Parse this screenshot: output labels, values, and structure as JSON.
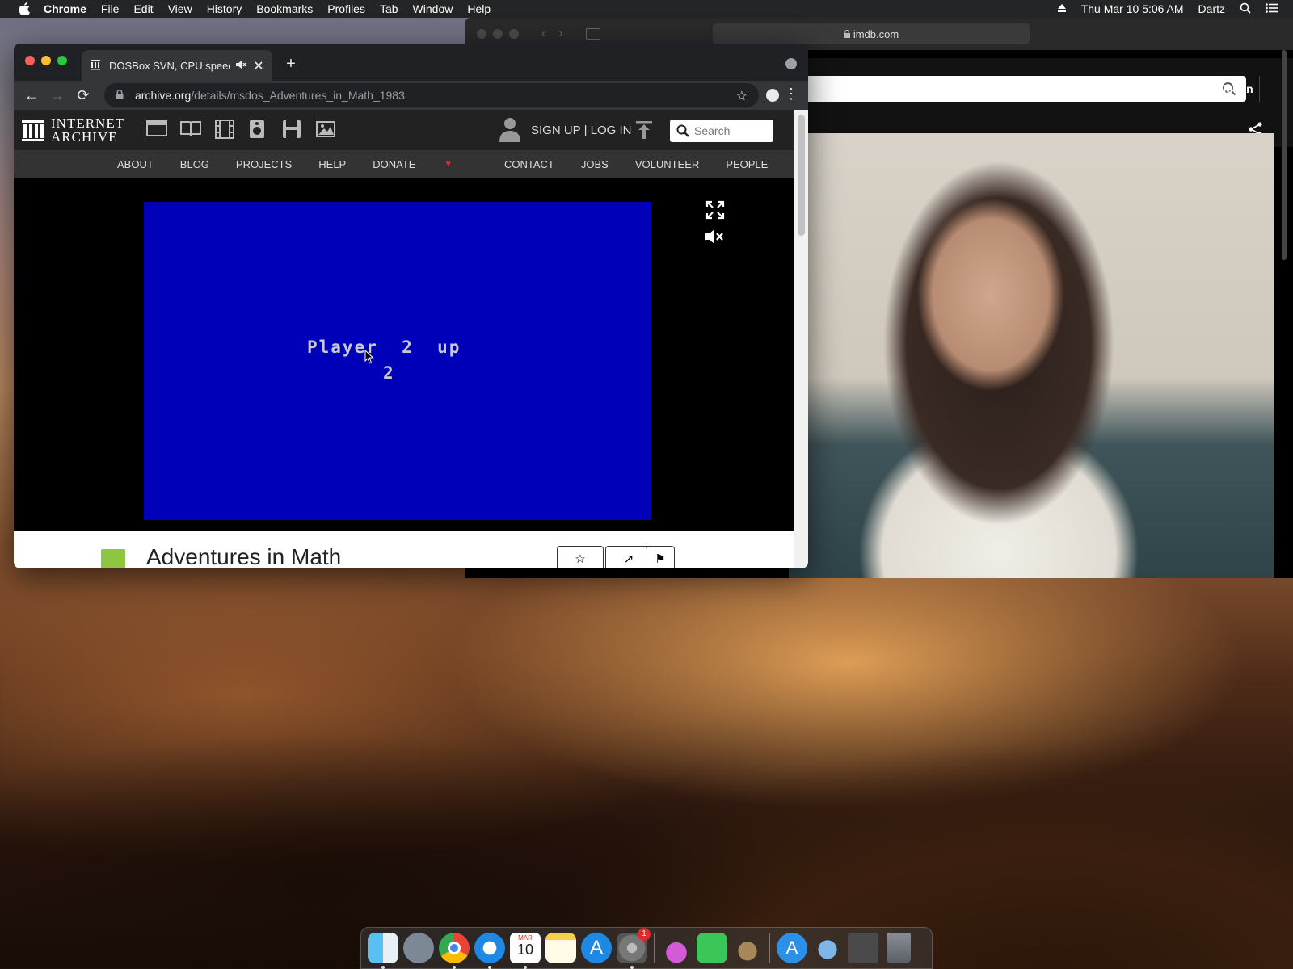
{
  "menubar": {
    "app": "Chrome",
    "menus": [
      "File",
      "Edit",
      "View",
      "History",
      "Bookmarks",
      "Profiles",
      "Tab",
      "Window",
      "Help"
    ],
    "datetime": "Thu Mar 10  5:06 AM",
    "user": "Dartz"
  },
  "safari": {
    "address": "imdb.com",
    "signin": "Sign In"
  },
  "chrome": {
    "tab_title": "DOSBox SVN, CPU speed:",
    "url_host": "archive.org",
    "url_path": "/details/msdos_Adventures_in_Math_1983"
  },
  "archive": {
    "logo_line1": "INTERNET",
    "logo_line2": "ARCHIVE",
    "signup": "SIGN UP | LOG IN",
    "search_placeholder": "Search",
    "nav": [
      "ABOUT",
      "BLOG",
      "PROJECTS",
      "HELP",
      "DONATE",
      "CONTACT",
      "JOBS",
      "VOLUNTEER",
      "PEOPLE"
    ],
    "item_title": "Adventures in Math"
  },
  "emulator": {
    "line1": "Player  2  up",
    "line2": "2"
  },
  "dock": {
    "calendar_month": "MAR",
    "calendar_day": "10",
    "badge": "1"
  },
  "colors": {
    "dos_blue": "#0000b8",
    "chrome_dark": "#202124",
    "close_red": "#ff5f57",
    "min_yellow": "#febc2e",
    "max_green": "#28c840"
  }
}
